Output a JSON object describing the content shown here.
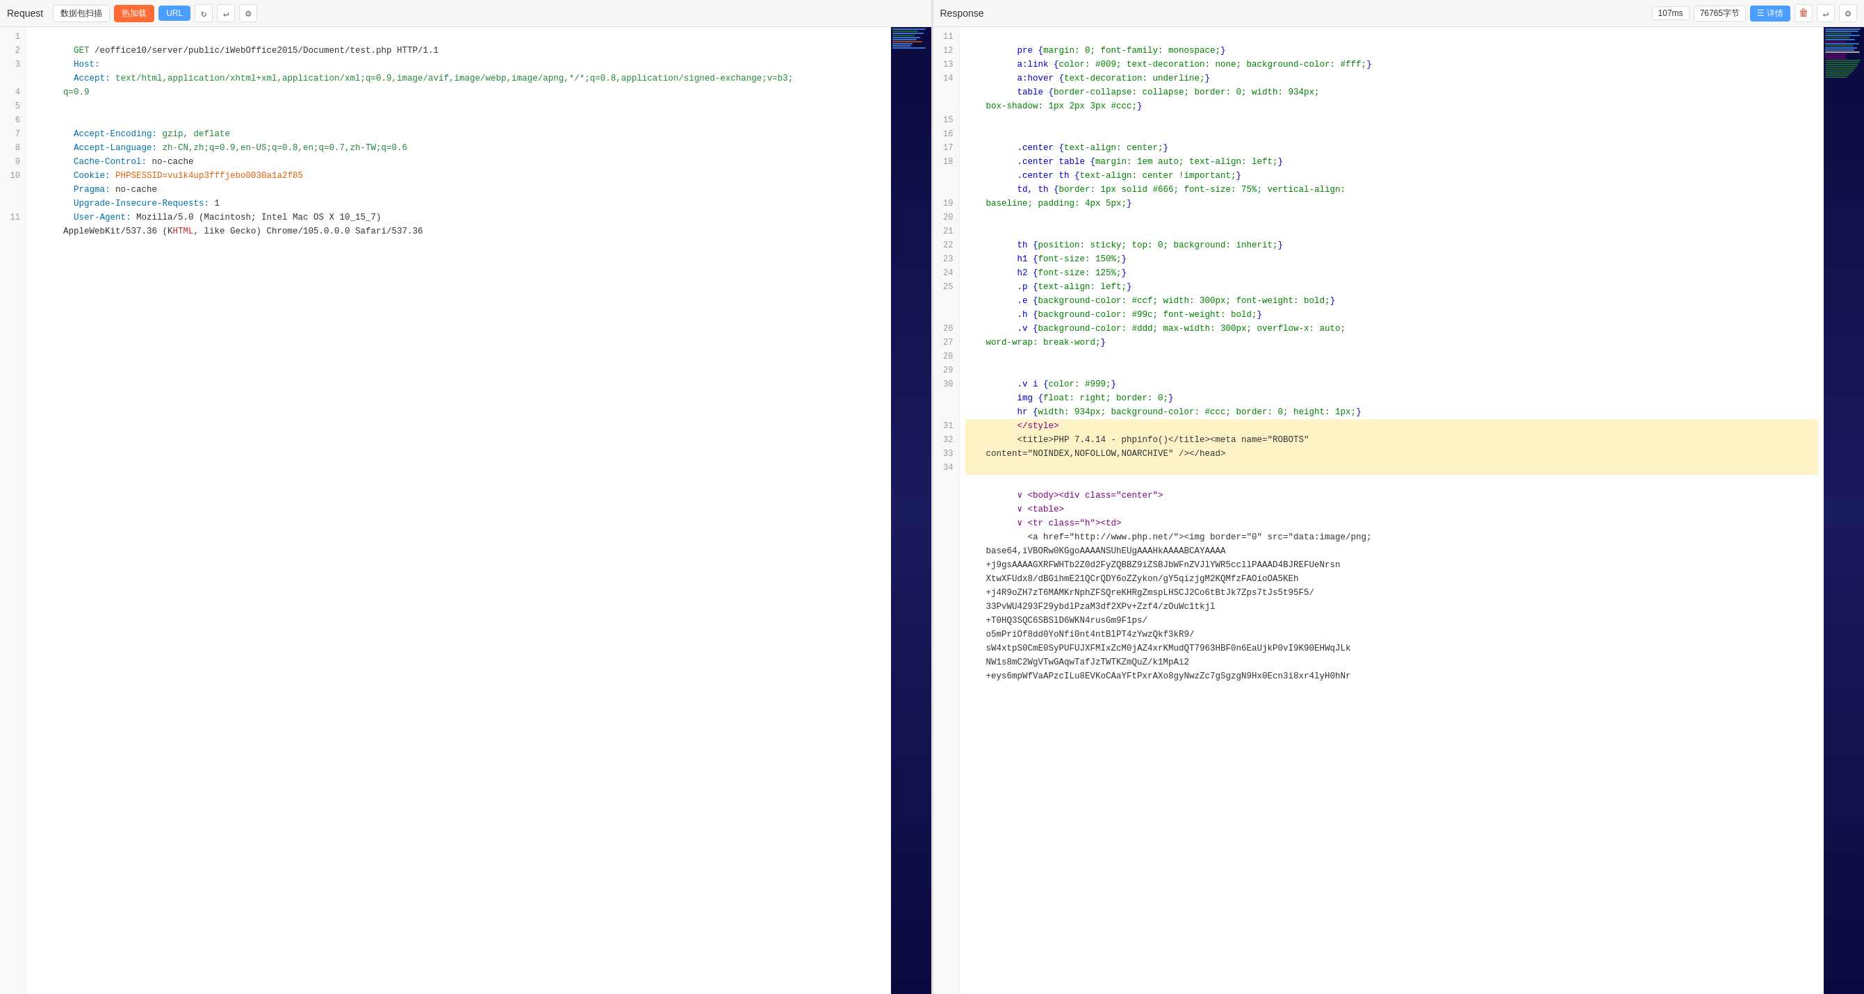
{
  "request": {
    "title": "Request",
    "buttons": {
      "scan": "数据包扫描",
      "hotreload": "热加载",
      "url": "URL"
    },
    "lines": [
      {
        "num": 1,
        "content": [
          {
            "text": "GET",
            "class": "c-green"
          },
          {
            "text": " /eoffice10/server/public/iWebOffice2015/Document/test.php HTTP/1.1",
            "class": ""
          }
        ]
      },
      {
        "num": 2,
        "content": [
          {
            "text": "Host:",
            "class": "c-teal"
          },
          {
            "text": "",
            "class": ""
          }
        ]
      },
      {
        "num": 3,
        "multiline": true,
        "content": [
          {
            "text": "Accept: ",
            "class": "c-teal"
          },
          {
            "text": "text/html,application/xhtml+xml,application/xml;q=0.9,image/avif,image/webp,image/apng,*/*;q=0.8,application/signed-exchange;v=b3;q=0.9",
            "class": "c-green"
          }
        ]
      },
      {
        "num": 4,
        "content": [
          {
            "text": "Accept-Encoding: ",
            "class": "c-teal"
          },
          {
            "text": "gzip, deflate",
            "class": "c-green"
          }
        ]
      },
      {
        "num": 5,
        "content": [
          {
            "text": "Accept-Language: ",
            "class": "c-teal"
          },
          {
            "text": "zh-CN,zh;q=0.9,en-US;q=0.8,en;q=0.7,zh-TW;q=0.6",
            "class": "c-green"
          }
        ]
      },
      {
        "num": 6,
        "content": [
          {
            "text": "Cache-Control: ",
            "class": "c-teal"
          },
          {
            "text": "no-cache",
            "class": ""
          }
        ]
      },
      {
        "num": 7,
        "content": [
          {
            "text": "Cookie: ",
            "class": "c-teal"
          },
          {
            "text": "PHPSESSID=vu1k4up3fffjebo0030a1a2f85",
            "class": "c-orange"
          }
        ]
      },
      {
        "num": 8,
        "content": [
          {
            "text": "Pragma: ",
            "class": "c-teal"
          },
          {
            "text": "no-cache",
            "class": ""
          }
        ]
      },
      {
        "num": 9,
        "content": [
          {
            "text": "Upgrade-Insecure-Requests: ",
            "class": "c-teal"
          },
          {
            "text": "1",
            "class": ""
          }
        ]
      },
      {
        "num": 10,
        "multiline": true,
        "content": [
          {
            "text": "User-Agent: ",
            "class": "c-teal"
          },
          {
            "text": "Mozilla/5.0 (Macintosh; Intel Mac OS X 10_15_7) AppleWebKit/537.36 (KHTML, like Gecko) Chrome/105.0.0.0 Safari/537.36",
            "class": ""
          }
        ]
      },
      {
        "num": 11,
        "content": [
          {
            "text": "",
            "class": ""
          }
        ]
      }
    ]
  },
  "response": {
    "title": "Response",
    "stats": {
      "time": "107ms",
      "size": "76765字节"
    },
    "buttons": {
      "detail": "详情"
    },
    "lines": [
      {
        "num": 11,
        "content": [
          {
            "text": "  pre {",
            "class": "c-blue"
          },
          {
            "text": "margin: 0; font-family: monospace;",
            "class": ""
          },
          {
            "text": "}",
            "class": "c-blue"
          }
        ]
      },
      {
        "num": 12,
        "content": [
          {
            "text": "  a:link {",
            "class": "c-blue"
          },
          {
            "text": "color: #009; text-decoration: none; background-color: #fff;",
            "class": ""
          },
          {
            "text": "}",
            "class": "c-blue"
          }
        ]
      },
      {
        "num": 13,
        "content": [
          {
            "text": "  a:hover {",
            "class": "c-blue"
          },
          {
            "text": "text-decoration: underline;",
            "class": ""
          },
          {
            "text": "}",
            "class": "c-blue"
          }
        ]
      },
      {
        "num": 14,
        "multiline": true,
        "content": [
          {
            "text": "  table {",
            "class": "c-blue"
          },
          {
            "text": "border-collapse: collapse; border: 0; width: 934px; box-shadow: 1px 2px 3px #ccc;",
            "class": ""
          },
          {
            "text": "}",
            "class": "c-blue"
          }
        ]
      },
      {
        "num": 15,
        "content": [
          {
            "text": "  .center {",
            "class": "c-blue"
          },
          {
            "text": "text-align: center;",
            "class": ""
          },
          {
            "text": "}",
            "class": "c-blue"
          }
        ]
      },
      {
        "num": 16,
        "content": [
          {
            "text": "  .center table {",
            "class": "c-blue"
          },
          {
            "text": "margin: 1em auto; text-align: left;",
            "class": ""
          },
          {
            "text": "}",
            "class": "c-blue"
          }
        ]
      },
      {
        "num": 17,
        "content": [
          {
            "text": "  .center th {",
            "class": "c-blue"
          },
          {
            "text": "text-align: center !important;",
            "class": ""
          },
          {
            "text": "}",
            "class": "c-blue"
          }
        ]
      },
      {
        "num": 18,
        "multiline": true,
        "content": [
          {
            "text": "  td, th {",
            "class": "c-blue"
          },
          {
            "text": "border: 1px solid #666; font-size: 75%; vertical-align: baseline; padding: 4px 5px;",
            "class": ""
          },
          {
            "text": "}",
            "class": "c-blue"
          }
        ]
      },
      {
        "num": 19,
        "content": [
          {
            "text": "  th {",
            "class": "c-blue"
          },
          {
            "text": "position: sticky; top: 0; background: inherit;",
            "class": ""
          },
          {
            "text": "}",
            "class": "c-blue"
          }
        ]
      },
      {
        "num": 20,
        "content": [
          {
            "text": "  h1 {",
            "class": "c-blue"
          },
          {
            "text": "font-size: 150%;",
            "class": ""
          },
          {
            "text": "}",
            "class": "c-blue"
          }
        ]
      },
      {
        "num": 21,
        "content": [
          {
            "text": "  h2 {",
            "class": "c-blue"
          },
          {
            "text": "font-size: 125%;",
            "class": ""
          },
          {
            "text": "}",
            "class": "c-blue"
          }
        ]
      },
      {
        "num": 22,
        "content": [
          {
            "text": "  .p {",
            "class": "c-blue"
          },
          {
            "text": "text-align: left;",
            "class": ""
          },
          {
            "text": "}",
            "class": "c-blue"
          }
        ]
      },
      {
        "num": 23,
        "content": [
          {
            "text": "  .e {",
            "class": "c-blue"
          },
          {
            "text": "background-color: #ccf; width: 300px; font-weight: bold;",
            "class": ""
          },
          {
            "text": "}",
            "class": "c-blue"
          }
        ]
      },
      {
        "num": 24,
        "content": [
          {
            "text": "  .h {",
            "class": "c-blue"
          },
          {
            "text": "background-color: #99c; font-weight: bold;",
            "class": ""
          },
          {
            "text": "}",
            "class": "c-blue"
          }
        ]
      },
      {
        "num": 25,
        "multiline": true,
        "content": [
          {
            "text": "  .v {",
            "class": "c-blue"
          },
          {
            "text": "background-color: #ddd; max-width: 300px; overflow-x: auto; word-wrap: break-word;",
            "class": ""
          },
          {
            "text": "}",
            "class": "c-blue"
          }
        ]
      },
      {
        "num": 26,
        "content": [
          {
            "text": "  .v i {",
            "class": "c-blue"
          },
          {
            "text": "color: #999;",
            "class": ""
          },
          {
            "text": "}",
            "class": "c-blue"
          }
        ]
      },
      {
        "num": 27,
        "content": [
          {
            "text": "  img {",
            "class": "c-blue"
          },
          {
            "text": "float: right; border: 0;",
            "class": ""
          },
          {
            "text": "}",
            "class": "c-blue"
          }
        ]
      },
      {
        "num": 28,
        "content": [
          {
            "text": "  hr {",
            "class": "c-blue"
          },
          {
            "text": "width: 934px; background-color: #ccc; border: 0; height: 1px;",
            "class": ""
          },
          {
            "text": "}",
            "class": "c-blue"
          }
        ]
      },
      {
        "num": 29,
        "content": [
          {
            "text": "  </style>",
            "class": "c-purple"
          }
        ]
      },
      {
        "num": 30,
        "highlighted": true,
        "multiline": true,
        "content": [
          {
            "text": "  <title>PHP 7.4.14 - phpinfo()</title><meta name=\"ROBOTS\" content=\"NOINDEX,NOFOLLOW,NOARCHIVE\" /></head>",
            "class": ""
          }
        ]
      },
      {
        "num": 31,
        "content": [
          {
            "text": "  ∨ <body><div class=\"center\">",
            "class": "c-purple"
          }
        ]
      },
      {
        "num": 32,
        "content": [
          {
            "text": "  ∨ <table>",
            "class": "c-purple"
          }
        ]
      },
      {
        "num": 33,
        "content": [
          {
            "text": "  ∨ <tr class=\"h\"><td>",
            "class": "c-purple"
          }
        ]
      },
      {
        "num": 34,
        "multiline": true,
        "content": [
          {
            "text": "    <a href=\"http://www.php.net/\"><img border=\"0\" src=\"data:image/png; base64,iVBORw0KGgoAAAANSUhEUgAAAHkAAAABCAYAAAA +j9gsAAAAGXRFWHTb2Z0d2FyZQBBZ9iZSBJbWFnZVJlYWR5ccllPAAAD4BJREFUeNrsnXtwXFUdx8/dBGihmE21QCrQDY6oZZykon/gY5qizjgM2KQMfzFAOioOA5KEh +j4R9oZH7zT6MAMKrNphZFSQreKHRgZmspLHSCJ2Co6tBtJk7Zps7tJs5t95F5/ 33PvWU4293F29ybdlPzaM3df2XPv+Zzf4/zOuWc1tkjl +T0HQ3SQC6SBSlD6WKN4rusGm9F1ps/ o5mPriOf8dd0YoNfi0nt4ntBlPT4zYwzQkf3kR9/ sW4xtpS0CmE0SyPUFUJXFMIxZcM0jAZ4xrKMudQT7963HBF0n6EaUjkP0vI9K90EHWqJLk NW1s8mC2WgVTwGAqwTafJzTWTKZmQuZ/k1MpAi2 +eys6mpWfVaAPzcILu8EVKoCAaYFtPxrAXo8gyNwzZc7gSgzgN9Hx0Ecn3i8xr4lyH0hNr",
            "class": "c-darkgreen"
          }
        ]
      }
    ]
  }
}
